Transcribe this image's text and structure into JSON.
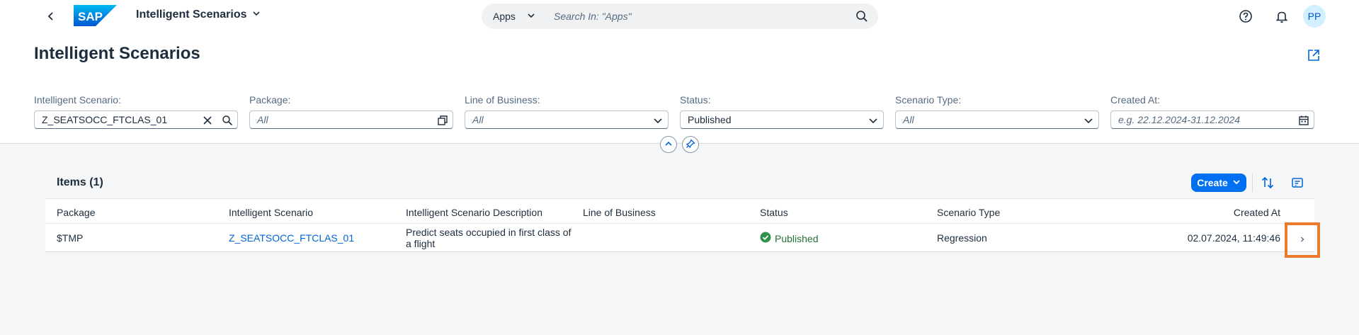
{
  "shell": {
    "app_title": "Intelligent Scenarios",
    "search_scope": "Apps",
    "search_placeholder": "Search In: \"Apps\"",
    "avatar_initials": "PP",
    "logo_text": "SAP"
  },
  "page": {
    "title": "Intelligent Scenarios"
  },
  "filters": [
    {
      "label": "Intelligent Scenario:",
      "value": "Z_SEATSOCC_FTCLAS_01",
      "placeholder": ""
    },
    {
      "label": "Package:",
      "value": "",
      "placeholder": "All"
    },
    {
      "label": "Line of Business:",
      "value": "",
      "placeholder": "All"
    },
    {
      "label": "Status:",
      "value": "Published",
      "placeholder": ""
    },
    {
      "label": "Scenario Type:",
      "value": "",
      "placeholder": "All"
    },
    {
      "label": "Created At:",
      "value": "",
      "placeholder": "e.g. 22.12.2024-31.12.2024"
    }
  ],
  "table": {
    "title": "Items (1)",
    "create_label": "Create",
    "columns": [
      "Package",
      "Intelligent Scenario",
      "Intelligent Scenario Description",
      "Line of Business",
      "Status",
      "Scenario Type",
      "Created At"
    ],
    "rows": [
      {
        "package": "$TMP",
        "scenario": "Z_SEATSOCC_FTCLAS_01",
        "description_line1": "Predict seats occupied in first class of",
        "description_line2": "a flight",
        "line_of_business": "",
        "status": "Published",
        "scenario_type": "Regression",
        "created_at": "02.07.2024, 11:49:46"
      }
    ]
  },
  "colors": {
    "accent": "#0070f2",
    "link": "#0064d9",
    "success": "#256f3a",
    "highlight": "#ec7a2b"
  }
}
